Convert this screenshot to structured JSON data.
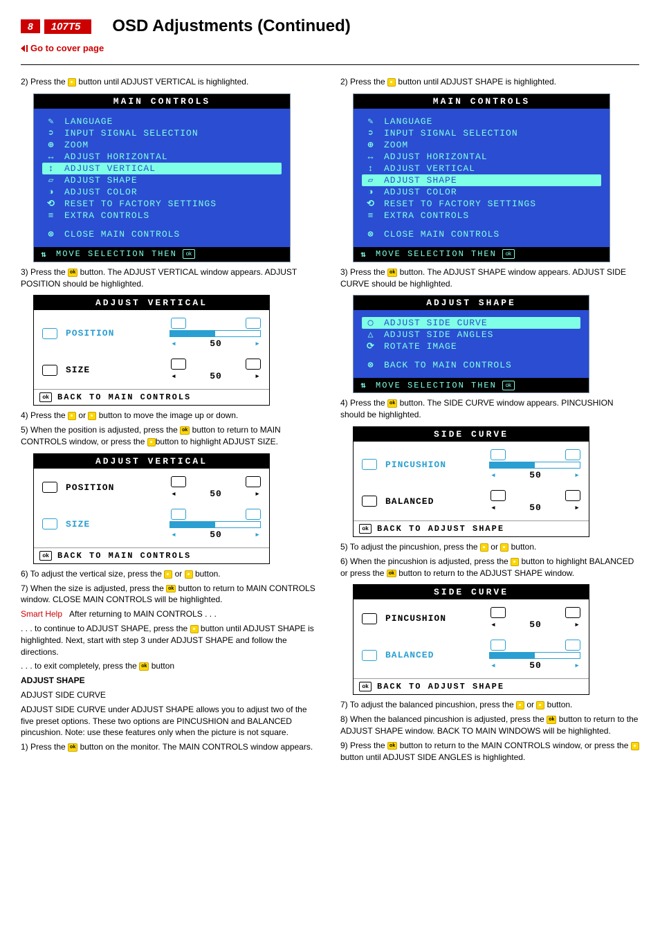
{
  "page_number": "8",
  "model": "107T5",
  "title": "OSD Adjustments (Continued)",
  "cover_link": "Go to cover page",
  "left": {
    "step2": "2) Press the",
    "step2b": "button until ADJUST VERTICAL is highlighted.",
    "mc_title": "MAIN CONTROLS",
    "mc_items": [
      "LANGUAGE",
      "INPUT SIGNAL SELECTION",
      "ZOOM",
      "ADJUST HORIZONTAL",
      "ADJUST VERTICAL",
      "ADJUST SHAPE",
      "ADJUST COLOR",
      "RESET TO FACTORY SETTINGS",
      "EXTRA CONTROLS"
    ],
    "mc_close": "CLOSE MAIN CONTROLS",
    "mc_footer": "MOVE SELECTION THEN",
    "step3": "3) Press the",
    "step3b": "button. The ADJUST VERTICAL window appears. ADJUST POSITION should be highlighted.",
    "av_title": "ADJUST VERTICAL",
    "av_position": "POSITION",
    "av_size": "SIZE",
    "av_val": "50",
    "av_back": "BACK TO MAIN CONTROLS",
    "step4": "4) Press the",
    "step4b": "or",
    "step4c": "button to move the image up or down.",
    "step5": "5) When the position is adjusted, press the",
    "step5b": "button to return to MAIN CONTROLS window, or press the",
    "step5c": "button to highlight ADJUST SIZE.",
    "step6": "6) To adjust the vertical size, press the",
    "step6b": "or",
    "step6c": "button.",
    "step7": "7) When the size is adjusted, press the",
    "step7b": "button to return to MAIN CONTROLS window. CLOSE MAIN CONTROLS will be highlighted.",
    "smarthelp": "Smart Help",
    "smarthelp_txt": "After returning to MAIN CONTROLS . . .",
    "cont1": ". . . to continue to ADJUST SHAPE, press the",
    "cont1b": "button until ADJUST SHAPE is highlighted. Next, start with step 3 under ADJUST SHAPE and follow the directions.",
    "cont2": ". . . to exit completely, press the",
    "cont2b": "button",
    "adj_shape_hdr": "ADJUST SHAPE",
    "adj_side_curve": "ADJUST SIDE CURVE",
    "adj_side_curve_desc": "ADJUST SIDE CURVE under ADJUST SHAPE allows you to adjust two of the five preset options. These two options are PINCUSHION and BALANCED pincushion. Note: use these features only when the picture is not square.",
    "step1b": "1) Press the",
    "step1c": "button on the monitor. The MAIN CONTROLS window appears."
  },
  "right": {
    "step2": "2) Press the",
    "step2b": "button until ADJUST SHAPE is highlighted.",
    "mc_title": "MAIN CONTROLS",
    "mc_footer": "MOVE SELECTION THEN",
    "mc_close": "CLOSE MAIN CONTROLS",
    "step3": "3) Press the",
    "step3b": "button. The ADJUST SHAPE window appears. ADJUST SIDE CURVE should be highlighted.",
    "as_title": "ADJUST SHAPE",
    "as_items": [
      "ADJUST SIDE CURVE",
      "ADJUST SIDE ANGLES",
      "ROTATE IMAGE"
    ],
    "as_back": "BACK TO MAIN CONTROLS",
    "as_footer": "MOVE SELECTION THEN",
    "step4": "4) Press the",
    "step4b": "button. The SIDE CURVE window appears. PINCUSHION should be highlighted.",
    "sc_title": "SIDE CURVE",
    "sc_pin": "PINCUSHION",
    "sc_bal": "BALANCED",
    "sc_val": "50",
    "sc_back": "BACK TO ADJUST SHAPE",
    "step5": "5) To adjust the pincushion, press the",
    "step5b": "or",
    "step5c": "button.",
    "step6": "6) When the pincushion is adjusted, press the",
    "step6b": "button to highlight BALANCED or press the",
    "step6c": "button to return to the ADJUST SHAPE window.",
    "step7": "7) To adjust the balanced pincushion, press the",
    "step7b": "or",
    "step7c": "button.",
    "step8": "8) When the balanced pincushion is adjusted, press the",
    "step8b": "button to return to the ADJUST SHAPE window. BACK TO MAIN WINDOWS will be highlighted.",
    "step9": "9) Press the",
    "step9b": "button to return to the MAIN CONTROLS window, or press the",
    "step9c": "button until ADJUST SIDE ANGLES is highlighted."
  }
}
